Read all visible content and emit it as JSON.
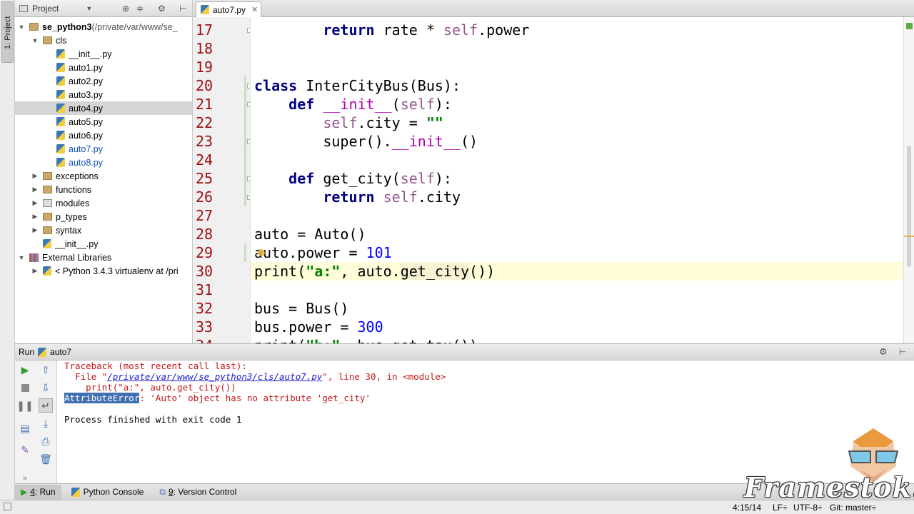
{
  "left_stripe": {
    "project_tab": "1: Project"
  },
  "project": {
    "header_title": "Project",
    "tree": [
      {
        "label": "se_python3",
        "suffix": " (/private/var/www/se_",
        "kind": "folder",
        "indent": 0,
        "expanded": true
      },
      {
        "label": "cls",
        "kind": "folder",
        "indent": 1,
        "expanded": true
      },
      {
        "label": "__init__.py",
        "kind": "py",
        "indent": 2
      },
      {
        "label": "auto1.py",
        "kind": "py",
        "indent": 2
      },
      {
        "label": "auto2.py",
        "kind": "py",
        "indent": 2
      },
      {
        "label": "auto3.py",
        "kind": "py",
        "indent": 2
      },
      {
        "label": "auto4.py",
        "kind": "py",
        "indent": 2,
        "selected": true
      },
      {
        "label": "auto5.py",
        "kind": "py",
        "indent": 2
      },
      {
        "label": "auto6.py",
        "kind": "py",
        "indent": 2
      },
      {
        "label": "auto7.py",
        "kind": "py",
        "indent": 2,
        "blue": true
      },
      {
        "label": "auto8.py",
        "kind": "py",
        "indent": 2,
        "blue": true
      },
      {
        "label": "exceptions",
        "kind": "folder",
        "indent": 1,
        "expanded": false
      },
      {
        "label": "functions",
        "kind": "folder",
        "indent": 1,
        "expanded": false
      },
      {
        "label": "modules",
        "kind": "folder-plain",
        "indent": 1,
        "expanded": false
      },
      {
        "label": "p_types",
        "kind": "folder",
        "indent": 1,
        "expanded": false
      },
      {
        "label": "syntax",
        "kind": "folder",
        "indent": 1,
        "expanded": false
      },
      {
        "label": "__init__.py",
        "kind": "py",
        "indent": 1
      },
      {
        "label": "External Libraries",
        "kind": "lib",
        "indent": 0,
        "expanded": true
      },
      {
        "label": "< Python 3.4.3 virtualenv at /pri",
        "kind": "py",
        "indent": 1,
        "expanded": false
      }
    ]
  },
  "editor": {
    "tab_label": "auto7.py",
    "current_line": "30",
    "lines": [
      {
        "n": "17",
        "html": "        <span class=\"kw\">return</span> rate * <span class=\"slf\">self</span>.power"
      },
      {
        "n": "18",
        "html": ""
      },
      {
        "n": "19",
        "html": ""
      },
      {
        "n": "20",
        "html": "<span class=\"kw\">class</span> InterCityBus(Bus):"
      },
      {
        "n": "21",
        "html": "    <span class=\"kw\">def</span> <span class=\"mag\">__init__</span>(<span class=\"slf\">self</span>):"
      },
      {
        "n": "22",
        "html": "        <span class=\"slf\">self</span>.city = <span class=\"str\">\"\"</span>"
      },
      {
        "n": "23",
        "html": "        super().<span class=\"mag\">__init__</span>()"
      },
      {
        "n": "24",
        "html": ""
      },
      {
        "n": "25",
        "html": "    <span class=\"kw\">def</span> get_city(<span class=\"slf\">self</span>):"
      },
      {
        "n": "26",
        "html": "        <span class=\"kw\">return</span> <span class=\"slf\">self</span>.city"
      },
      {
        "n": "27",
        "html": ""
      },
      {
        "n": "28",
        "html": "auto = Auto()"
      },
      {
        "n": "29",
        "html": "auto.power = <span class=\"num\">101</span>"
      },
      {
        "n": "30",
        "html": "print(<span class=\"str\">\"a:\"</span>, auto.<span class=\"hl\">get_city</span>())"
      },
      {
        "n": "31",
        "html": ""
      },
      {
        "n": "32",
        "html": "bus = Bus()"
      },
      {
        "n": "33",
        "html": "bus.power = <span class=\"num\">300</span>"
      },
      {
        "n": "34",
        "html": "print(<span class=\"str\">\"b:\"</span>, bus.get_tax())"
      }
    ]
  },
  "run": {
    "header_label": "Run",
    "config_name": "auto7",
    "console": {
      "line1": "Traceback (most recent call last):",
      "line2_prefix": "  File \"",
      "line2_link": "/private/var/www/se_python3/cls/auto7.py",
      "line2_suffix": "\", line 30, in <module>",
      "line3": "    print(\"a:\", auto.get_city())",
      "line4_selected": "AttributeError",
      "line4_rest": ": 'Auto' object has no attribute 'get_city'",
      "line5": "Process finished with exit code 1"
    }
  },
  "tool_tabs": {
    "run_num": "4",
    "run_label": ": Run",
    "console_label": "Python Console",
    "vcs_num": "9",
    "vcs_label": ": Version Control"
  },
  "status": {
    "position": "4:15/14",
    "line_sep": "LF÷",
    "encoding": "UTF-8÷",
    "vcs": "Git: master÷"
  },
  "watermark": "Framestok.ru"
}
